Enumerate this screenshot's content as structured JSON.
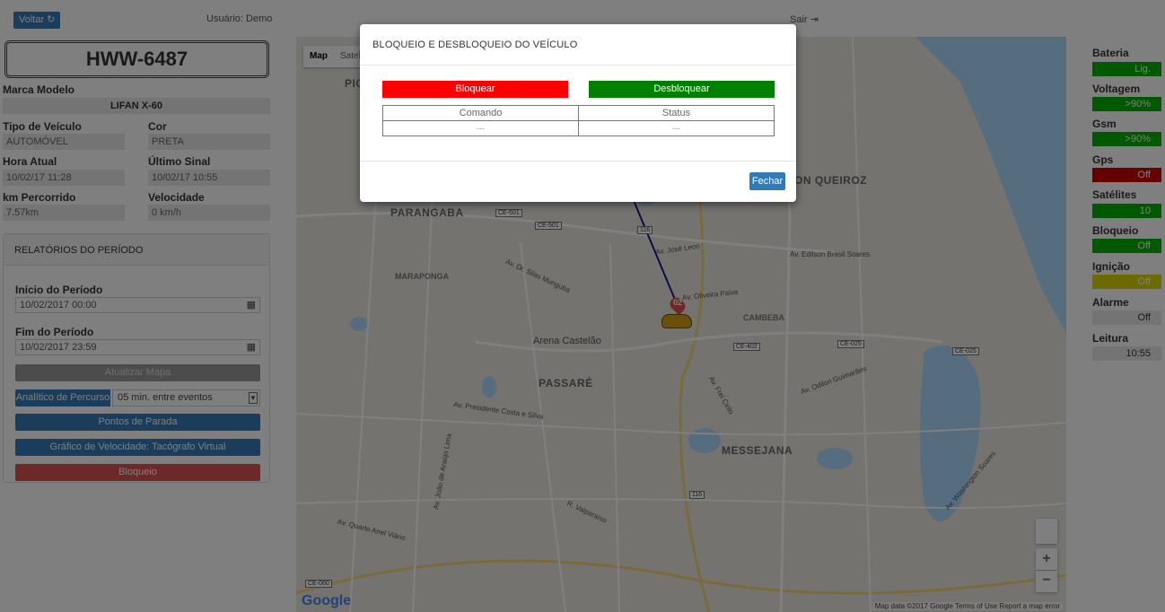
{
  "header": {
    "back_label": "Voltar",
    "back_icon": "refresh-icon",
    "user_label": "Usuário: Demo",
    "logout_label": "Sair",
    "logout_icon": "sign-out-icon"
  },
  "vehicle": {
    "plate": "HWW-6487",
    "brand_model_label": "Marca Modelo",
    "brand_model": "LIFAN X-60",
    "type_label": "Tipo de Veículo",
    "type": "AUTOMÓVEL",
    "color_label": "Cor",
    "color": "PRETA",
    "current_time_label": "Hora Atual",
    "current_time": "10/02/17 11:28",
    "last_signal_label": "Último Sinal",
    "last_signal": "10/02/17 10:55",
    "km_label": "km Percorrido",
    "km": "7.57km",
    "speed_label": "Velocidade",
    "speed": "0 km/h"
  },
  "report": {
    "title": "RELATÓRIOS DO PERÍODO",
    "start_label": "Início do Período",
    "start_value": "10/02/2017 00:00",
    "end_label": "Fim do Período",
    "end_value": "10/02/2017 23:59",
    "update_map": "Atualizar Mapa",
    "route_analysis": "Analítico de Percurso",
    "interval_option": "05 min. entre eventos",
    "stops": "Pontos de Parada",
    "speed_chart": "Gráfico de Velocidade: Tacógrafo Virtual",
    "block": "Bloqueio"
  },
  "map": {
    "type_map": "Map",
    "type_satellite": "Satellite",
    "labels": {
      "parangaba": "PARANGABA",
      "maraponga": "MARAPONGA",
      "passare": "PASSARÉ",
      "messejana": "MESSEJANA",
      "cambeba": "CAMBEBA",
      "queiroz": "ON QUEIROZ",
      "arena": "Arena Castelão",
      "av_jose_leon": "Av. José Leon",
      "av_dr_silas": "Av. Dr. Silas Munguba",
      "av_presidente": "Av. Presidente Costa e Silva",
      "av_quarto": "Av. Quarto Anel Viário",
      "av_edilson": "Av. Edilson Brasil Soares",
      "av_oliveira": "Av. Oliveira Paiva",
      "av_odilon": "Av. Odilon Guimarães",
      "av_washington": "Av. Washington Soares",
      "av_frei": "Av. Frei Cirilo",
      "pic": "PIC",
      "av_joao": "Av. João de Araújo Lima",
      "av_valparaiso": "R. Valparaíso"
    },
    "shields": {
      "ce501a": "CE-501",
      "ce501b": "CE-501",
      "r116a": "116",
      "ce402": "CE-402",
      "ce025a": "CE-025",
      "ce025b": "CE-025",
      "r116b": "116",
      "ce060": "CE-060"
    },
    "marker_label": "02",
    "google": "Google",
    "footer": "Map data ©2017 Google   Terms of Use   Report a map error",
    "zoom_in": "+",
    "zoom_out": "−"
  },
  "status": {
    "battery_label": "Bateria",
    "battery": "Lig.",
    "voltage_label": "Voltagem",
    "voltage": ">90%",
    "gsm_label": "Gsm",
    "gsm": ">90%",
    "gps_label": "Gps",
    "gps": "Off",
    "satellites_label": "Satélites",
    "satellites": "10",
    "lock_label": "Bloqueio",
    "lock": "Off",
    "ignition_label": "Ignição",
    "ignition": "Off",
    "alarm_label": "Alarme",
    "alarm": "Off",
    "reading_label": "Leitura",
    "reading": "10:55"
  },
  "modal": {
    "title": "BLOQUEIO E DESBLOQUEIO DO VEÍCULO",
    "block_button": "Bloquear",
    "unblock_button": "Desbloquear",
    "col_command": "Comando",
    "col_status": "Status",
    "row_command": "---",
    "row_status": "---",
    "close_button": "Fechar"
  }
}
